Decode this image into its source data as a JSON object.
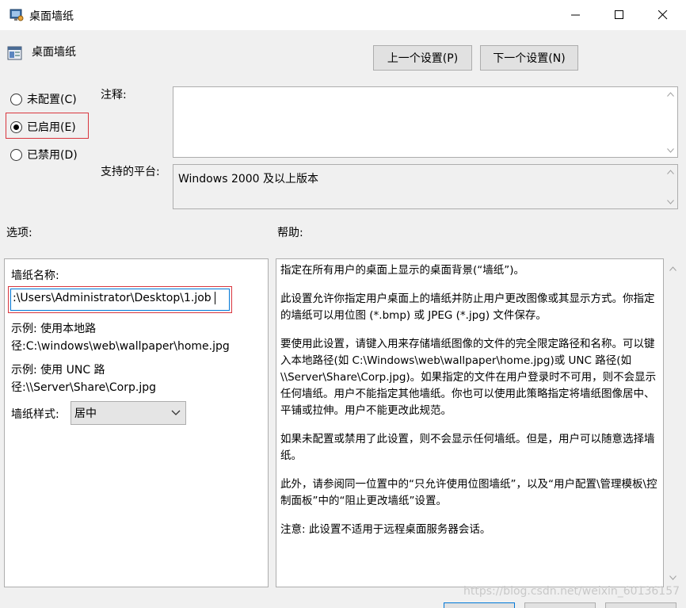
{
  "window": {
    "title": "桌面墙纸",
    "controls": {
      "minimize": "—",
      "maximize": "☐",
      "close": "✕"
    }
  },
  "header": {
    "policy_name": "桌面墙纸"
  },
  "nav": {
    "prev": "上一个设置(P)",
    "next": "下一个设置(N)"
  },
  "state": {
    "options": [
      {
        "label": "未配置(C)",
        "checked": false
      },
      {
        "label": "已启用(E)",
        "checked": true
      },
      {
        "label": "已禁用(D)",
        "checked": false
      }
    ]
  },
  "comment": {
    "label": "注释:",
    "value": ""
  },
  "platform": {
    "label": "支持的平台:",
    "value": "Windows 2000 及以上版本"
  },
  "options_panel": {
    "heading": "选项:",
    "wallpaper_name_label": "墙纸名称:",
    "wallpaper_name_value": ":\\Users\\Administrator\\Desktop\\1.job",
    "example_local_1": "示例: 使用本地路",
    "example_local_2": "径:C:\\windows\\web\\wallpaper\\home.jpg",
    "example_unc_1": "示例: 使用 UNC 路",
    "example_unc_2": "径:\\\\Server\\Share\\Corp.jpg",
    "style_label": "墙纸样式:",
    "style_value": "居中"
  },
  "help_panel": {
    "heading": "帮助:",
    "paragraphs": [
      "指定在所有用户的桌面上显示的桌面背景(“墙纸”)。",
      "此设置允许你指定用户桌面上的墙纸并防止用户更改图像或其显示方式。你指定的墙纸可以用位图 (*.bmp) 或 JPEG (*.jpg) 文件保存。",
      "要使用此设置，请键入用来存储墙纸图像的文件的完全限定路径和名称。可以键入本地路径(如 C:\\Windows\\web\\wallpaper\\home.jpg)或 UNC 路径(如 \\\\Server\\Share\\Corp.jpg)。如果指定的文件在用户登录时不可用，则不会显示任何墙纸。用户不能指定其他墙纸。你也可以使用此策略指定将墙纸图像居中、平铺或拉伸。用户不能更改此规范。",
      "如果未配置或禁用了此设置，则不会显示任何墙纸。但是，用户可以随意选择墙纸。",
      "此外，请参阅同一位置中的“只允许使用位图墙纸”，以及“用户配置\\管理模板\\控制面板”中的“阻止更改墙纸”设置。",
      "注意: 此设置不适用于远程桌面服务器会话。"
    ]
  },
  "watermark": "https://blog.csdn.net/weixin_60136157",
  "icons": {
    "app": "group-policy-icon",
    "header": "policy-setting-icon",
    "dropdown": "chevron-down-icon",
    "scroll_up": "scroll-up-arrow-icon",
    "scroll_down": "scroll-down-arrow-icon"
  },
  "colors": {
    "highlight": "#d9363e",
    "window_bg": "#f0f0f0"
  }
}
